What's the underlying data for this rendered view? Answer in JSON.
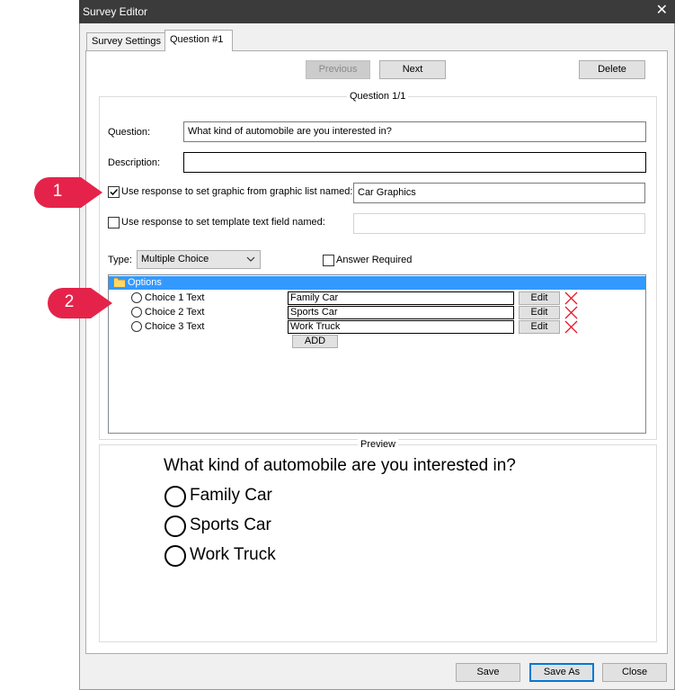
{
  "window": {
    "title": "Survey Editor",
    "close_glyph": "✕"
  },
  "tabs": [
    {
      "label": "Survey Settings",
      "selected": false
    },
    {
      "label": "Question #1",
      "selected": true
    }
  ],
  "nav": {
    "previous_label": "Previous",
    "next_label": "Next",
    "delete_label": "Delete"
  },
  "question_group": {
    "title": "Question 1/1",
    "question_label": "Question:",
    "question_value": "What kind of automobile are you interested in?",
    "description_label": "Description:",
    "description_value": "",
    "graphic_checkbox_label": "Use response to set graphic from graphic list named:",
    "graphic_checked": true,
    "graphic_list_value": "Car Graphics",
    "template_checkbox_label": "Use response to set template text field named:",
    "template_checked": false,
    "template_value": "",
    "type_label": "Type:",
    "type_value": "Multiple Choice",
    "answer_required_label": "Answer Required",
    "answer_required_checked": false
  },
  "options": {
    "header": "Options",
    "items": [
      {
        "label": "Choice 1 Text",
        "value": "Family Car",
        "edit_label": "Edit"
      },
      {
        "label": "Choice 2 Text",
        "value": "Sports Car",
        "edit_label": "Edit"
      },
      {
        "label": "Choice 3 Text",
        "value": "Work Truck",
        "edit_label": "Edit"
      }
    ],
    "add_label": "ADD"
  },
  "preview": {
    "title": "Preview",
    "question": "What kind of automobile are you interested in?",
    "choices": [
      "Family Car",
      "Sports Car",
      "Work Truck"
    ]
  },
  "footer": {
    "save_label": "Save",
    "save_as_label": "Save As",
    "close_label": "Close"
  },
  "callouts": [
    "1",
    "2"
  ],
  "colors": {
    "title_bar": "#3b3b3b",
    "selection_blue": "#3399ff",
    "focus_border": "#0078d7",
    "callout_red": "#e5234a",
    "delete_red": "#e81123"
  }
}
